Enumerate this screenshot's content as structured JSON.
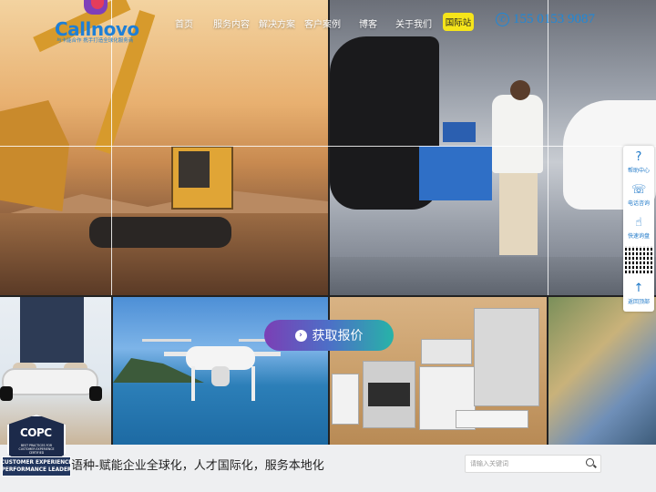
{
  "brand": {
    "name": "Callnovo",
    "tagline": "与卡能合作 携手打造全球化服务商",
    "colors": {
      "primary": "#1e7fd6",
      "accent": "#7f3fb9",
      "highlight": "#f6e51a"
    }
  },
  "nav": {
    "items": [
      "首页",
      "服务内容",
      "解决方案",
      "客户案例",
      "博客",
      "关于我们"
    ],
    "intl_badge": "国际站"
  },
  "phone": {
    "number": "155 0153 9087",
    "icon": "phone-icon"
  },
  "hero": {
    "quote_button": "获取报价"
  },
  "sidebar": {
    "items": [
      {
        "label": "帮助中心",
        "icon": "help-icon",
        "glyph": "?"
      },
      {
        "label": "电话咨询",
        "icon": "headset-icon",
        "glyph": "☏"
      },
      {
        "label": "快速询盘",
        "icon": "hand-icon",
        "glyph": "☝"
      },
      {
        "label": "返回顶部",
        "icon": "arrow-up-icon",
        "glyph": "↑"
      }
    ]
  },
  "bottom": {
    "slogan": "语种-赋能企业全球化，人才国际化，服务本地化",
    "search_placeholder": "请输入关键词"
  },
  "badge": {
    "word": "COPC",
    "small": "BEST PRACTICES FOR CUSTOMER EXPERIENCE CERTIFIED",
    "line1": "CUSTOMER EXPERIENCE",
    "line2": "PERFORMANCE LEADER"
  }
}
